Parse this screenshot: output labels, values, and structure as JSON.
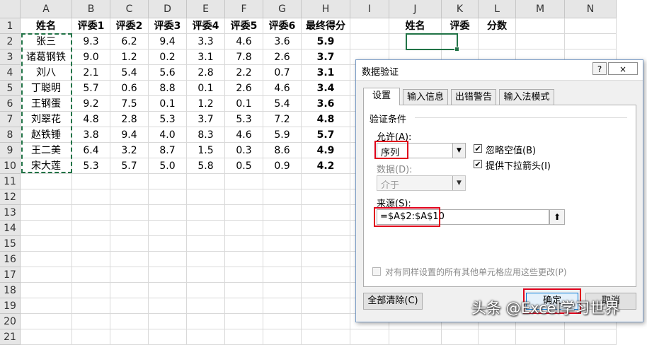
{
  "sheet": {
    "columns": [
      "A",
      "B",
      "C",
      "D",
      "E",
      "F",
      "G",
      "H",
      "I",
      "J",
      "K",
      "L",
      "M",
      "N"
    ],
    "rows": [
      "1",
      "2",
      "3",
      "4",
      "5",
      "6",
      "7",
      "8",
      "9",
      "10",
      "11",
      "12",
      "13",
      "14",
      "15",
      "16",
      "17",
      "18",
      "19",
      "20",
      "21"
    ],
    "header_row": [
      "姓名",
      "评委1",
      "评委2",
      "评委3",
      "评委4",
      "评委5",
      "评委6",
      "最终得分"
    ],
    "data_rows": [
      [
        "张三",
        "9.3",
        "6.2",
        "9.4",
        "3.3",
        "4.6",
        "3.6",
        "5.9"
      ],
      [
        "诸葛钢铁",
        "9.0",
        "1.2",
        "0.2",
        "3.1",
        "7.8",
        "2.6",
        "3.7"
      ],
      [
        "刘八",
        "2.1",
        "5.4",
        "5.6",
        "2.8",
        "2.2",
        "0.7",
        "3.1"
      ],
      [
        "丁聪明",
        "5.7",
        "0.6",
        "8.8",
        "0.1",
        "2.6",
        "4.6",
        "3.4"
      ],
      [
        "王钢蛋",
        "9.2",
        "7.5",
        "0.1",
        "1.2",
        "0.1",
        "5.4",
        "3.6"
      ],
      [
        "刘翠花",
        "4.8",
        "2.8",
        "5.3",
        "3.7",
        "5.3",
        "7.2",
        "4.8"
      ],
      [
        "赵铁锤",
        "3.8",
        "9.4",
        "4.0",
        "8.3",
        "4.6",
        "5.9",
        "5.7"
      ],
      [
        "王二美",
        "6.4",
        "3.2",
        "8.7",
        "1.5",
        "0.3",
        "8.6",
        "4.9"
      ],
      [
        "宋大莲",
        "5.3",
        "5.7",
        "5.0",
        "5.8",
        "0.5",
        "0.9",
        "4.2"
      ]
    ],
    "lookup_headers": [
      "姓名",
      "评委",
      "分数"
    ]
  },
  "dialog": {
    "title": "数据验证",
    "help_button": "?",
    "close_icon": "×",
    "tabs": [
      "设置",
      "输入信息",
      "出错警告",
      "输入法模式"
    ],
    "section_title": "验证条件",
    "allow_label": "允许(A):",
    "allow_value": "序列",
    "data_label": "数据(D):",
    "data_value": "介于",
    "ignore_blank_label": "忽略空值(B)",
    "dropdown_label": "提供下拉箭头(I)",
    "source_label": "来源(S):",
    "source_value": "=$A$2:$A$10",
    "apply_all_label": "对有同样设置的所有其他单元格应用这些更改(P)",
    "clear_all_button": "全部清除(C)",
    "ok_button": "确定",
    "cancel_button": "取消"
  },
  "watermark": "头条 @Excel学习世界",
  "colors": {
    "highlight_red": "#e0001b",
    "selection_green": "#217346"
  }
}
